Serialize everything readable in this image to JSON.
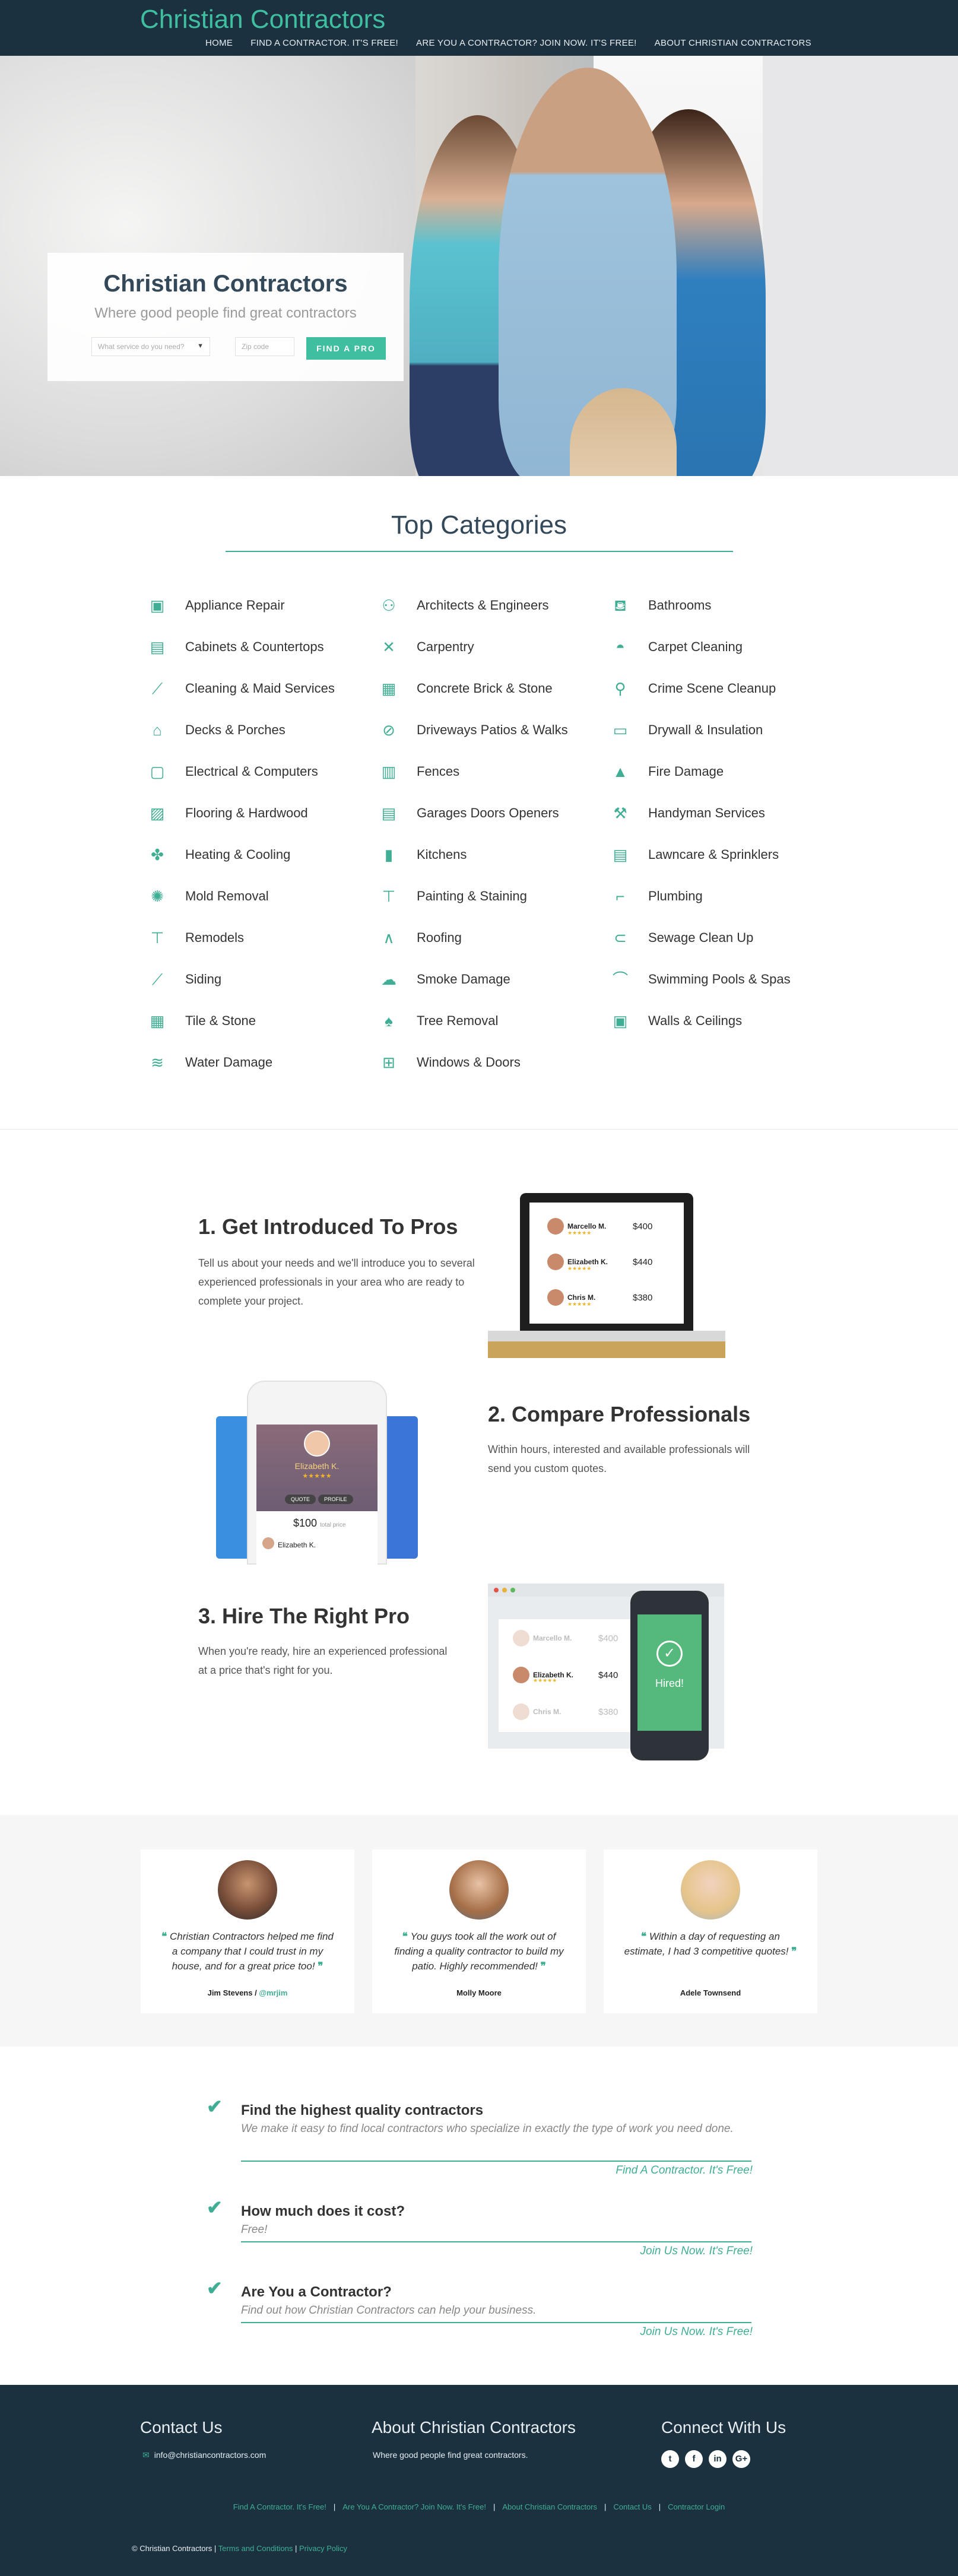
{
  "header": {
    "brand": "Christian Contractors",
    "nav": [
      "HOME",
      "FIND A CONTRACTOR. IT'S FREE!",
      "ARE YOU A CONTRACTOR? JOIN NOW. IT'S FREE!",
      "ABOUT CHRISTIAN CONTRACTORS"
    ]
  },
  "hero": {
    "title": "Christian Contractors",
    "subtitle": "Where good people find great contractors",
    "service_placeholder": "What service do you need?",
    "zip_placeholder": "Zip code",
    "button": "FIND A PRO"
  },
  "categories": {
    "title": "Top Categories",
    "items": [
      {
        "label": "Appliance Repair",
        "icon": "appliance-icon",
        "glyph": "▣"
      },
      {
        "label": "Architects & Engineers",
        "icon": "architect-icon",
        "glyph": "⚇"
      },
      {
        "label": "Bathrooms",
        "icon": "bathtub-icon",
        "glyph": "⛾"
      },
      {
        "label": "Cabinets & Countertops",
        "icon": "cabinet-icon",
        "glyph": "▤"
      },
      {
        "label": "Carpentry",
        "icon": "tools-icon",
        "glyph": "✕"
      },
      {
        "label": "Carpet Cleaning",
        "icon": "vacuum-icon",
        "glyph": "◓"
      },
      {
        "label": "Cleaning & Maid Services",
        "icon": "broom-icon",
        "glyph": "⟋"
      },
      {
        "label": "Concrete Brick & Stone",
        "icon": "brick-icon",
        "glyph": "▦"
      },
      {
        "label": "Crime Scene Cleanup",
        "icon": "crime-icon",
        "glyph": "⚲"
      },
      {
        "label": "Decks & Porches",
        "icon": "deck-icon",
        "glyph": "⌂"
      },
      {
        "label": "Driveways Patios & Walks",
        "icon": "driveway-icon",
        "glyph": "⊘"
      },
      {
        "label": "Drywall & Insulation",
        "icon": "drywall-icon",
        "glyph": "▭"
      },
      {
        "label": "Electrical & Computers",
        "icon": "computer-icon",
        "glyph": "▢"
      },
      {
        "label": "Fences",
        "icon": "fence-icon",
        "glyph": "▥"
      },
      {
        "label": "Fire Damage",
        "icon": "fire-icon",
        "glyph": "▲"
      },
      {
        "label": "Flooring & Hardwood",
        "icon": "flooring-icon",
        "glyph": "▨"
      },
      {
        "label": "Garages Doors Openers",
        "icon": "garage-icon",
        "glyph": "▤"
      },
      {
        "label": "Handyman Services",
        "icon": "handyman-icon",
        "glyph": "⚒"
      },
      {
        "label": "Heating & Cooling",
        "icon": "fan-icon",
        "glyph": "✤"
      },
      {
        "label": "Kitchens",
        "icon": "kitchen-icon",
        "glyph": "▮"
      },
      {
        "label": "Lawncare & Sprinklers",
        "icon": "lawn-icon",
        "glyph": "▤"
      },
      {
        "label": "Mold Removal",
        "icon": "mold-icon",
        "glyph": "✺"
      },
      {
        "label": "Painting & Staining",
        "icon": "paint-icon",
        "glyph": "⊤"
      },
      {
        "label": "Plumbing",
        "icon": "plumbing-icon",
        "glyph": "⌐"
      },
      {
        "label": "Remodels",
        "icon": "roller-icon",
        "glyph": "⊤"
      },
      {
        "label": "Roofing",
        "icon": "roof-icon",
        "glyph": "∧"
      },
      {
        "label": "Sewage Clean Up",
        "icon": "sewage-icon",
        "glyph": "⊂"
      },
      {
        "label": "Siding",
        "icon": "siding-icon",
        "glyph": "⟋"
      },
      {
        "label": "Smoke Damage",
        "icon": "smoke-icon",
        "glyph": "☁"
      },
      {
        "label": "Swimming Pools & Spas",
        "icon": "pool-icon",
        "glyph": "⌒"
      },
      {
        "label": "Tile & Stone",
        "icon": "tile-icon",
        "glyph": "▦"
      },
      {
        "label": "Tree Removal",
        "icon": "tree-icon",
        "glyph": "♠"
      },
      {
        "label": "Walls & Ceilings",
        "icon": "wall-icon",
        "glyph": "▣"
      },
      {
        "label": "Water Damage",
        "icon": "water-icon",
        "glyph": "≋"
      },
      {
        "label": "Windows & Doors",
        "icon": "window-icon",
        "glyph": "⊞"
      }
    ]
  },
  "steps": {
    "s1": {
      "title": "1. Get Introduced To Pros",
      "text": "Tell us about your needs and we'll introduce you to several experienced professionals in your area who are ready to complete your project."
    },
    "s2": {
      "title": "2. Compare Professionals",
      "text": "Within hours, interested and available professionals will send you custom quotes."
    },
    "s3": {
      "title": "3. Hire The Right Pro",
      "text": "When you're ready, hire an experienced professional at a price that's right for you."
    },
    "laptop_quotes": [
      {
        "name": "Marcello M.",
        "price": "$400"
      },
      {
        "name": "Elizabeth K.",
        "price": "$440"
      },
      {
        "name": "Chris M.",
        "price": "$380"
      }
    ],
    "phone": {
      "name": "Elizabeth K.",
      "btn1": "QUOTE",
      "btn2": "PROFILE",
      "price": "$100",
      "price_note": "total price",
      "bottom_name": "Elizabeth K."
    },
    "hired": {
      "rows": [
        {
          "name": "Marcello M.",
          "price": "$400"
        },
        {
          "name": "Elizabeth K.",
          "price": "$440"
        },
        {
          "name": "Chris M.",
          "price": "$380"
        }
      ],
      "label": "Hired!"
    }
  },
  "testimonials": [
    {
      "quote": "Christian Contractors helped me find a company that I could trust in my house, and for a great price too!",
      "name": "Jim Stevens",
      "handle": "@mrjim"
    },
    {
      "quote": "You guys took all the work out of finding a quality contractor to build my patio. Highly recommended!",
      "name": "Molly Moore",
      "handle": ""
    },
    {
      "quote": "Within a day of requesting an estimate, I had 3 competitive quotes!",
      "name": "Adele Townsend",
      "handle": ""
    }
  ],
  "features": [
    {
      "title": "Find the highest quality contractors",
      "text": "We make it easy to find local contractors who specialize in exactly the type of work you need done.",
      "link": "Find A Contractor. It's Free!"
    },
    {
      "title": "How much does it cost?",
      "text": "Free!",
      "link": "Join Us Now. It's Free!"
    },
    {
      "title": "Are You a Contractor?",
      "text": "Find out how Christian Contractors can help your business.",
      "link": "Join Us Now. It's Free!"
    }
  ],
  "footer": {
    "contact_title": "Contact Us",
    "email": "info@christiancontractors.com",
    "about_title": "About Christian Contractors",
    "about_text": "Where good people find great contractors.",
    "connect_title": "Connect With Us",
    "social": [
      "t",
      "f",
      "in",
      "G+"
    ],
    "links": [
      "Find A Contractor. It's Free!",
      "Are You A Contractor? Join Now. It's Free!",
      "About Christian Contractors",
      "Contact Us",
      "Contractor Login"
    ],
    "copyright": "© Christian Contractors",
    "terms": "Terms and Conditions",
    "privacy": "Privacy Policy"
  }
}
